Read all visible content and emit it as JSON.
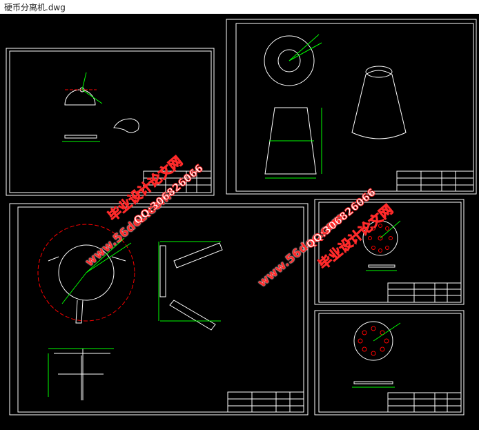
{
  "window": {
    "title": "硬币分离机.dwg"
  },
  "drawing": {
    "background_color": "#000000",
    "line_color": "#ffffff",
    "dimension_color": "#00ff00",
    "hidden_color": "#ff0000"
  },
  "watermarks": {
    "site": "www.56doc.com",
    "qq": "QQ:306826066",
    "brand": "毕业设计论文网"
  }
}
